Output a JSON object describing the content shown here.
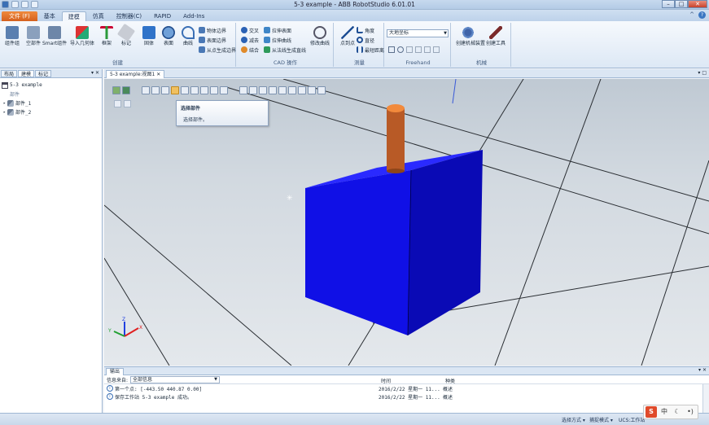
{
  "window": {
    "title": "5-3 example - ABB RobotStudio 6.01.01"
  },
  "ribbon_tabs": [
    {
      "label": "文件 (F)"
    },
    {
      "label": "基本"
    },
    {
      "label": "建模"
    },
    {
      "label": "仿真"
    },
    {
      "label": "控制器(C)"
    },
    {
      "label": "RAPID"
    },
    {
      "label": "Add-Ins"
    }
  ],
  "ribbon": {
    "create": {
      "label": "创建",
      "buttons": [
        "组件组",
        "空部件",
        "Smart组件",
        "导入几何体",
        "框架",
        "标记",
        "固体",
        "表面",
        "曲线"
      ]
    },
    "cad": {
      "label": "CAD 操作",
      "small": [
        "物体边界",
        "表面边界",
        "从点生成边界",
        "交叉",
        "减去",
        "结合",
        "拉伸表面",
        "拉伸曲线",
        "从法线生成直线"
      ],
      "big": [
        "修改曲线"
      ]
    },
    "measure": {
      "label": "测量",
      "big": [
        "点到点"
      ],
      "small": [
        "角度",
        "直径",
        "最短距离"
      ]
    },
    "freehand": {
      "label": "Freehand",
      "frame_select": "大地坐标"
    },
    "mechanism": {
      "label": "机械",
      "buttons": [
        "创建机械装置",
        "创建工具"
      ]
    }
  },
  "left_panel": {
    "tabs": [
      "布局",
      "建模",
      "标记"
    ],
    "pin": "▾ ✕",
    "tree": {
      "station": "5-3 example",
      "group_label": "部件",
      "parts": [
        "部件_1",
        "部件_2"
      ]
    }
  },
  "view": {
    "tab_label": "5-3 example:视图1",
    "pin": "▾ □",
    "tooltip": {
      "title": "选择部件",
      "description": "选择部件。"
    },
    "colors": {
      "box": "#1010e6",
      "cylinder": "#b85a26",
      "cylinder_top": "#f28a3c"
    }
  },
  "output": {
    "tab_label": "输出",
    "pin": "▾ ✕",
    "filter_label": "信息来自:",
    "filter_value": "全部信息",
    "col_time": "时间",
    "col_category": "种类",
    "rows": [
      {
        "message": "第一个点: [-443.50 440.87 0.00]",
        "time": "2016/2/22 星期一 11...",
        "category": "概述"
      },
      {
        "message": "保存工作站 5-3 example 成功。",
        "time": "2016/2/22 星期一 11...",
        "category": "概述"
      }
    ]
  },
  "status": {
    "select_mode": "选择方式 ▾",
    "snap_mode": "捕捉模式 ▾",
    "ucs": "UCS:工作站"
  },
  "ime": [
    "中",
    "☾",
    "•)"
  ]
}
